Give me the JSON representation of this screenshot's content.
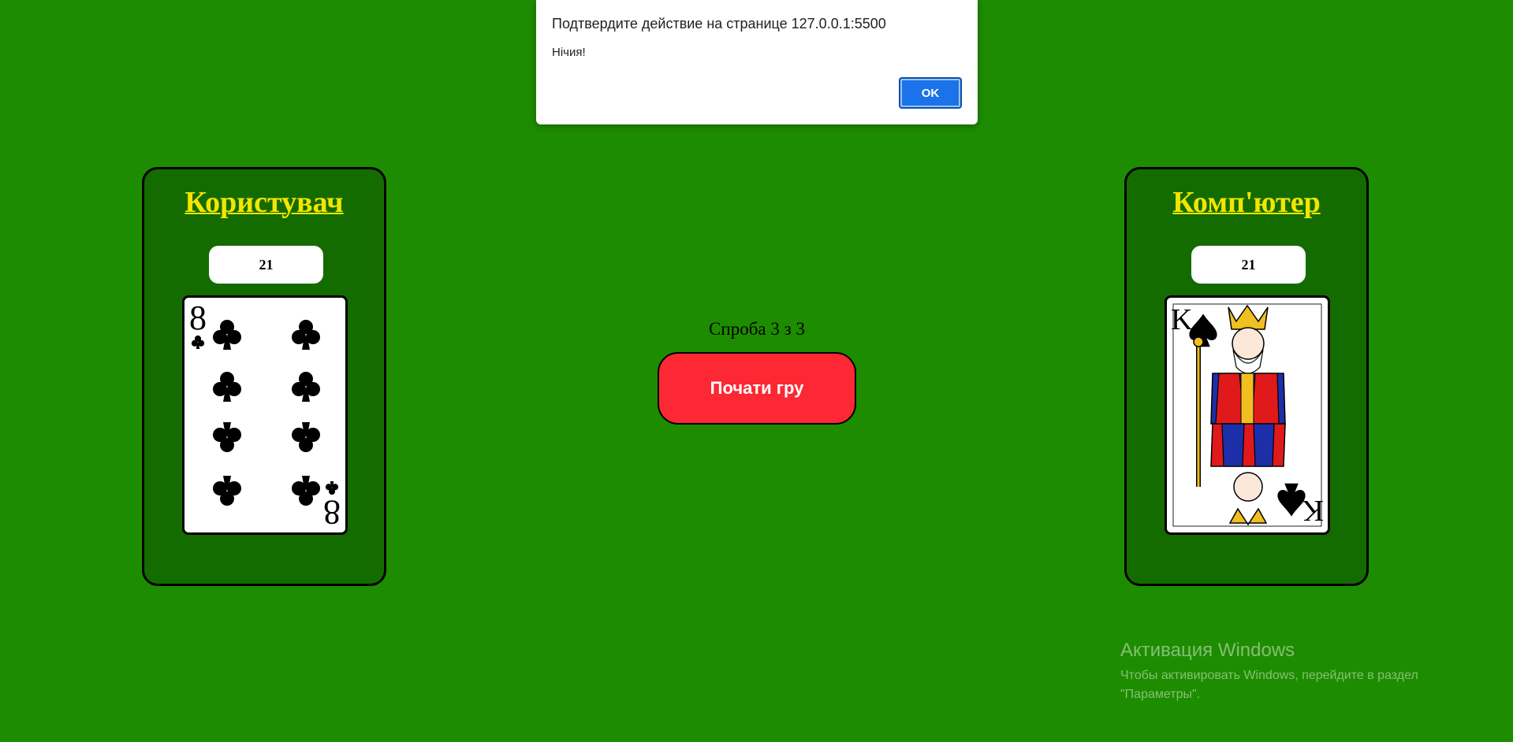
{
  "dialog": {
    "title": "Подтвердите действие на странице 127.0.0.1:5500",
    "message": "Нічия!",
    "ok_label": "OK"
  },
  "user": {
    "title": "Користувач",
    "score": "21",
    "card": {
      "rank": "8",
      "suit": "clubs",
      "suit_symbol": "♣"
    }
  },
  "computer": {
    "title": "Комп'ютер",
    "score": "21",
    "card": {
      "rank": "K",
      "suit": "spades",
      "suit_symbol": "♠"
    }
  },
  "center": {
    "attempt_text": "Спроба 3 з 3",
    "start_button": "Почати гру"
  },
  "watermark": {
    "title": "Активация Windows",
    "line1": "Чтобы активировать Windows, перейдите в раздел",
    "line2": "\"Параметры\"."
  },
  "colors": {
    "table": "#1e8c00",
    "panel": "#146c00",
    "title": "#f2e600",
    "button": "#fc2833",
    "ok": "#1a73e8"
  }
}
